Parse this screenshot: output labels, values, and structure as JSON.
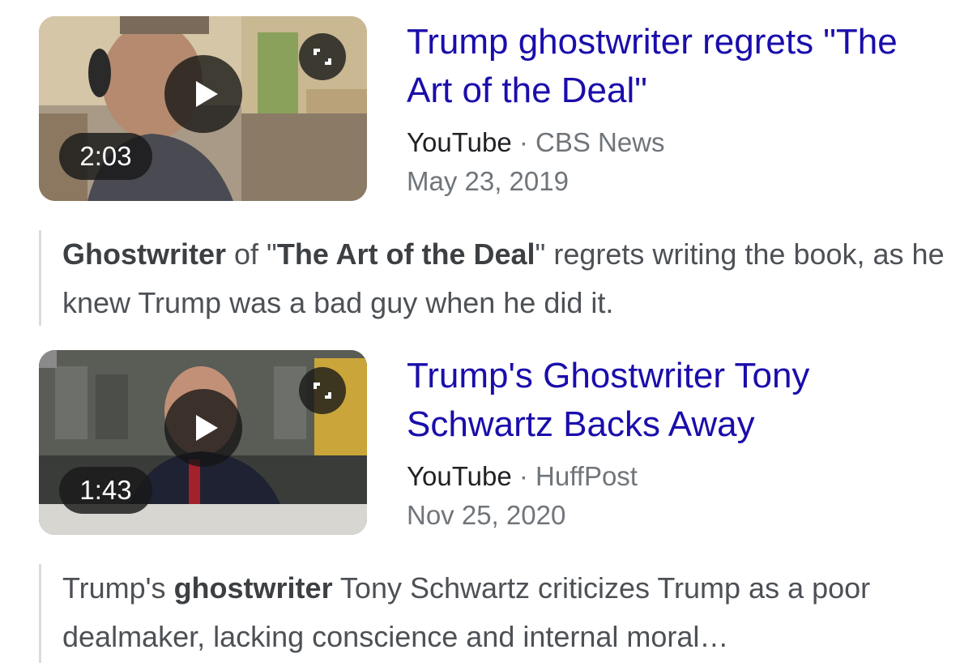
{
  "results": [
    {
      "title": "Trump ghostwriter regrets \"The Art of the Deal\"",
      "site": "YouTube",
      "separator": " · ",
      "channel": "CBS News",
      "date": "May 23, 2019",
      "duration": "2:03",
      "snippet": {
        "part1": "Ghostwriter",
        "part2": " of \"",
        "part3": "The Art of the Deal",
        "part4": "\" regrets writing the book, as he knew Trump was a bad guy when he did it."
      }
    },
    {
      "title": "Trump's Ghostwriter Tony Schwartz Backs Away",
      "site": "YouTube",
      "separator": " · ",
      "channel": "HuffPost",
      "date": "Nov 25, 2020",
      "duration": "1:43",
      "snippet": {
        "part1": "Trump's ",
        "part2": "ghostwriter",
        "part3": " Tony Schwartz criticizes Trump as a poor dealmaker, lacking conscience and internal moral…"
      }
    }
  ],
  "icons": {
    "play": "play-icon",
    "expand": "expand-icon"
  },
  "colors": {
    "link": "#1a0dab",
    "meta": "#70757a",
    "snippet": "#4d5156"
  }
}
